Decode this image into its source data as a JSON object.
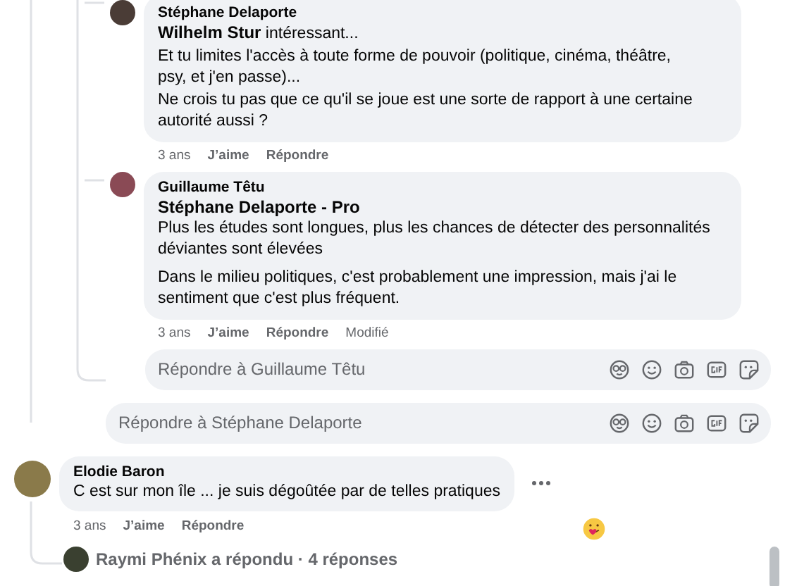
{
  "items": [
    {
      "kind": "reply_group",
      "children": [
        {
          "kind": "comment",
          "author": "Stéphane Delaporte",
          "paragraphs": [
            [
              "**Wilhelm Stur** intéressant...",
              "Et tu limites l'accès à toute forme de pouvoir (politique, cinéma, théâtre,",
              "psy, et j'en passe)...",
              "Ne crois tu pas que ce qu'il se joue est une sorte de rapport à une certaine",
              "autorité aussi ?"
            ]
          ],
          "time": "3 ans",
          "actions": [
            "J’aime",
            "Répondre"
          ]
        },
        {
          "kind": "comment",
          "author": "Guillaume Têtu",
          "heading": "Stéphane Delaporte - Pro",
          "paragraphs": [
            [
              "Plus les études sont longues, plus les chances de détecter des personnalités",
              "déviantes sont élevées"
            ],
            [
              "Dans le milieu politiques, c'est probablement une impression, mais j'ai le",
              "sentiment que c'est plus fréquent."
            ]
          ],
          "time": "3 ans",
          "actions": [
            "J’aime",
            "Répondre"
          ],
          "edited": "Modifié"
        },
        {
          "kind": "reply_field",
          "placeholder": "Répondre à Guillaume Têtu"
        }
      ]
    },
    {
      "kind": "reply_field",
      "placeholder": "Répondre à Stéphane Delaporte"
    },
    {
      "kind": "comment",
      "author": "Elodie Baron",
      "paragraphs": [
        [
          "C est sur mon île ... je suis dégoûtée par de telles pratiques"
        ]
      ],
      "time": "3 ans",
      "actions": [
        "J’aime",
        "Répondre"
      ],
      "more": true,
      "reaction": true,
      "replies_summary": {
        "text": "Raymi Phénix a répondu · 4 réponses"
      }
    }
  ]
}
